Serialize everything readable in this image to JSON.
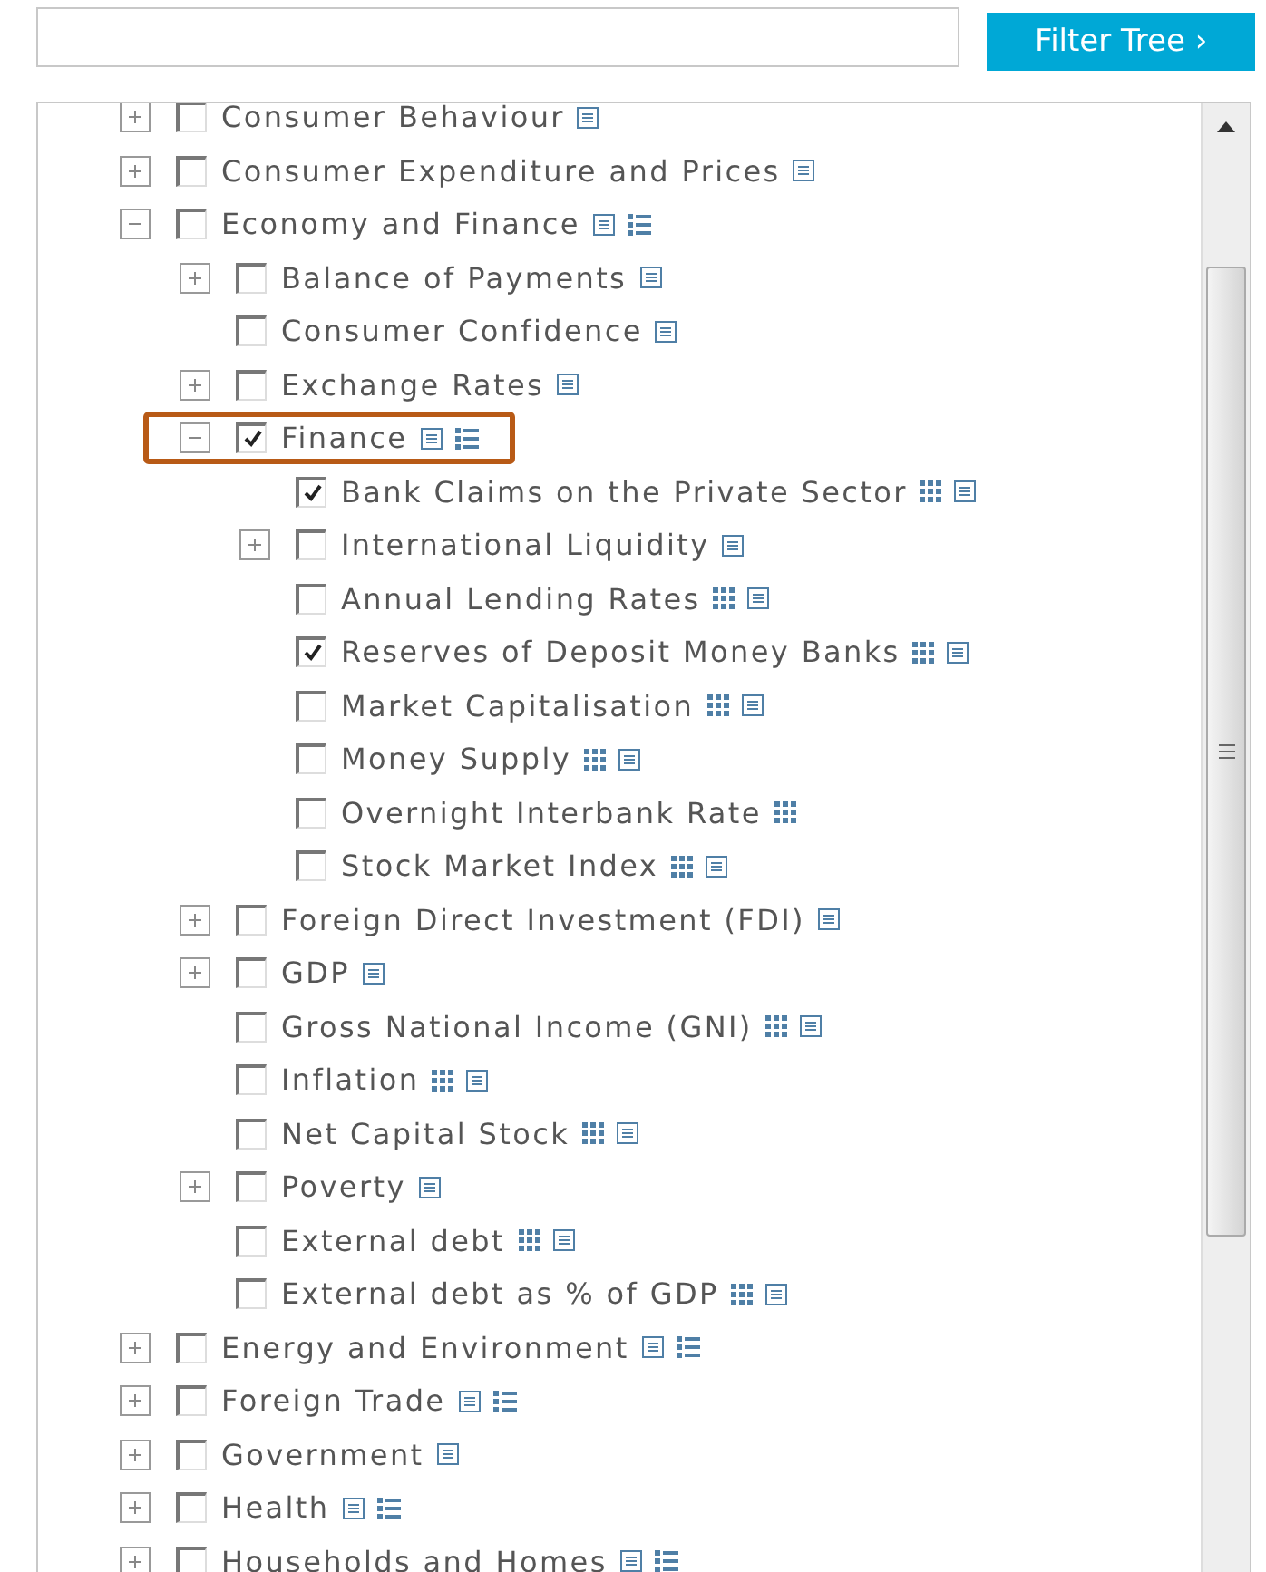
{
  "filter_button": {
    "label": "Filter Tree ›"
  },
  "tree": [
    {
      "label": "Consumer Behaviour",
      "checked": false,
      "expanded": false,
      "icons": [
        {
          "kind": "note"
        }
      ]
    },
    {
      "label": "Consumer Expenditure and Prices",
      "checked": false,
      "expanded": false,
      "icons": [
        {
          "kind": "note"
        }
      ]
    },
    {
      "label": "Economy and Finance",
      "checked": false,
      "expanded": true,
      "icons": [
        {
          "kind": "note"
        },
        {
          "kind": "list"
        }
      ],
      "children": [
        {
          "label": "Balance of Payments",
          "checked": false,
          "expanded": false,
          "icons": [
            {
              "kind": "note"
            }
          ]
        },
        {
          "label": "Consumer Confidence",
          "checked": false,
          "icons": [
            {
              "kind": "note"
            }
          ]
        },
        {
          "label": "Exchange Rates",
          "checked": false,
          "expanded": false,
          "icons": [
            {
              "kind": "note"
            }
          ]
        },
        {
          "label": "Finance",
          "checked": true,
          "expanded": true,
          "highlighted": true,
          "icons": [
            {
              "kind": "note"
            },
            {
              "kind": "list"
            }
          ],
          "children": [
            {
              "label": "Bank Claims on the Private Sector",
              "checked": true,
              "icons": [
                {
                  "kind": "grid"
                },
                {
                  "kind": "note"
                }
              ]
            },
            {
              "label": "International Liquidity",
              "checked": false,
              "expanded": false,
              "icons": [
                {
                  "kind": "note"
                }
              ]
            },
            {
              "label": "Annual Lending Rates",
              "checked": false,
              "icons": [
                {
                  "kind": "grid"
                },
                {
                  "kind": "note"
                }
              ]
            },
            {
              "label": "Reserves of Deposit Money Banks",
              "checked": true,
              "icons": [
                {
                  "kind": "grid"
                },
                {
                  "kind": "note"
                }
              ]
            },
            {
              "label": "Market Capitalisation",
              "checked": false,
              "icons": [
                {
                  "kind": "grid"
                },
                {
                  "kind": "note"
                }
              ]
            },
            {
              "label": "Money Supply",
              "checked": false,
              "icons": [
                {
                  "kind": "grid"
                },
                {
                  "kind": "note"
                }
              ]
            },
            {
              "label": "Overnight Interbank Rate",
              "checked": false,
              "icons": [
                {
                  "kind": "grid"
                }
              ]
            },
            {
              "label": "Stock Market Index",
              "checked": false,
              "icons": [
                {
                  "kind": "grid"
                },
                {
                  "kind": "note"
                }
              ]
            }
          ]
        },
        {
          "label": "Foreign Direct Investment (FDI)",
          "checked": false,
          "expanded": false,
          "icons": [
            {
              "kind": "note"
            }
          ]
        },
        {
          "label": "GDP",
          "checked": false,
          "expanded": false,
          "icons": [
            {
              "kind": "note"
            }
          ]
        },
        {
          "label": "Gross National Income (GNI)",
          "checked": false,
          "icons": [
            {
              "kind": "grid"
            },
            {
              "kind": "note"
            }
          ]
        },
        {
          "label": "Inflation",
          "checked": false,
          "icons": [
            {
              "kind": "grid"
            },
            {
              "kind": "note"
            }
          ]
        },
        {
          "label": "Net Capital Stock",
          "checked": false,
          "icons": [
            {
              "kind": "grid"
            },
            {
              "kind": "note"
            }
          ]
        },
        {
          "label": "Poverty",
          "checked": false,
          "expanded": false,
          "icons": [
            {
              "kind": "note"
            }
          ]
        },
        {
          "label": "External debt",
          "checked": false,
          "icons": [
            {
              "kind": "grid"
            },
            {
              "kind": "note"
            }
          ]
        },
        {
          "label": "External debt as % of GDP",
          "checked": false,
          "icons": [
            {
              "kind": "grid"
            },
            {
              "kind": "note"
            }
          ]
        }
      ]
    },
    {
      "label": "Energy and Environment",
      "checked": false,
      "expanded": false,
      "icons": [
        {
          "kind": "note"
        },
        {
          "kind": "list"
        }
      ]
    },
    {
      "label": "Foreign Trade",
      "checked": false,
      "expanded": false,
      "icons": [
        {
          "kind": "note"
        },
        {
          "kind": "list"
        }
      ]
    },
    {
      "label": "Government",
      "checked": false,
      "expanded": false,
      "icons": [
        {
          "kind": "note"
        }
      ]
    },
    {
      "label": "Health",
      "checked": false,
      "expanded": false,
      "icons": [
        {
          "kind": "note"
        },
        {
          "kind": "list"
        }
      ]
    },
    {
      "label": "Households and Homes",
      "checked": false,
      "expanded": false,
      "icons": [
        {
          "kind": "note"
        },
        {
          "kind": "list"
        }
      ]
    }
  ]
}
